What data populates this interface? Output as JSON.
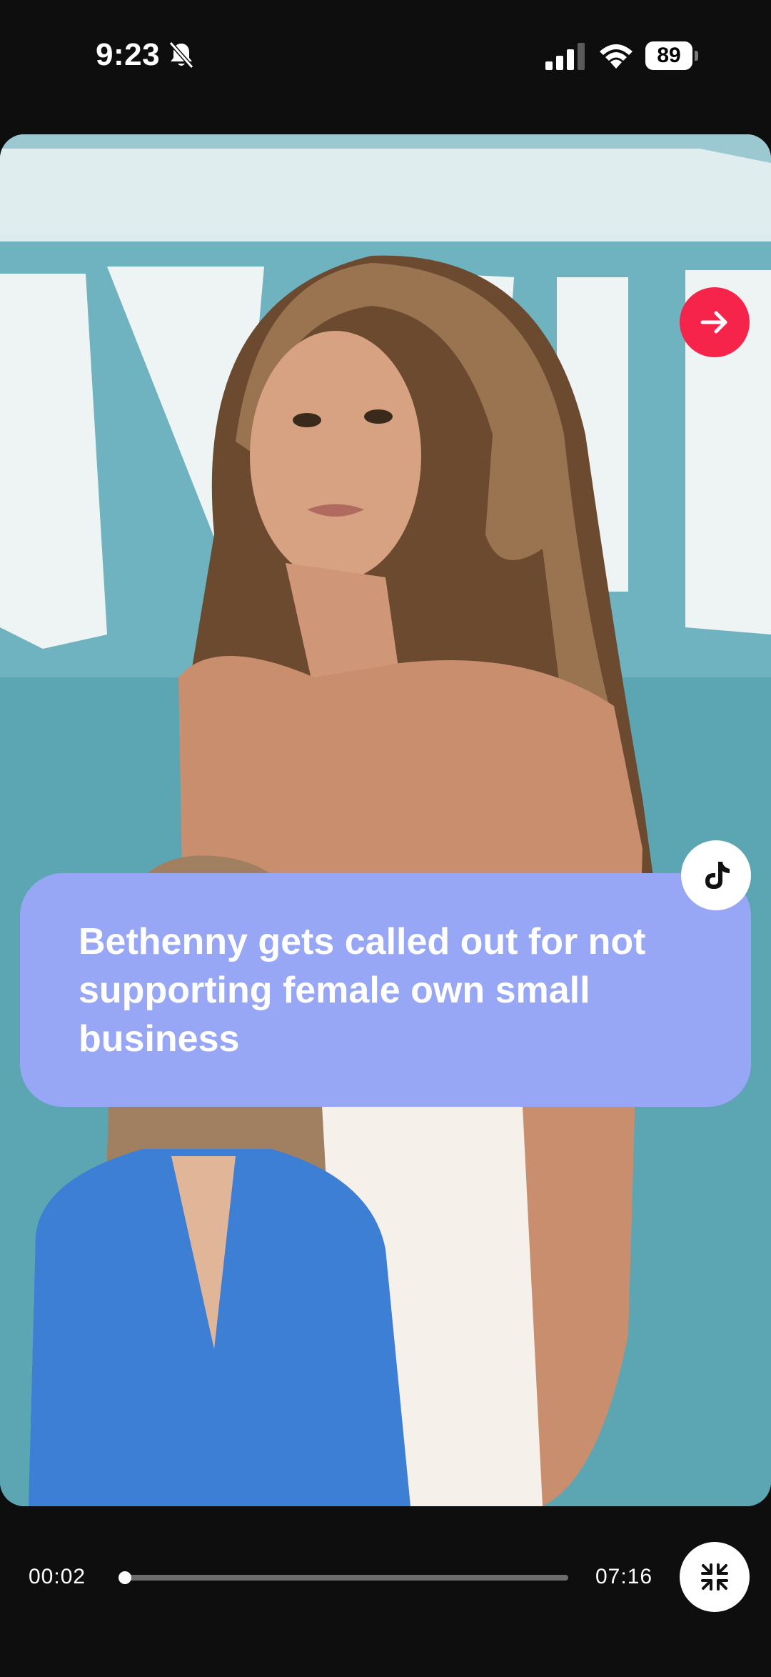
{
  "status_bar": {
    "time": "9:23",
    "battery_percent": "89",
    "icons": [
      "bell-slash-icon",
      "cellular-signal-icon",
      "wifi-icon",
      "battery-icon"
    ]
  },
  "media": {
    "next_icon": "arrow-right-icon",
    "platform_icon": "tiktok-icon",
    "caption": "Bethenny gets called out for not supporting female own small business",
    "accent_color": "#f6234a",
    "caption_bg_color": "#97a6f5"
  },
  "player": {
    "current_time": "00:02",
    "total_time": "07:16",
    "progress_fraction": 0.005,
    "minimize_icon": "collapse-icon"
  }
}
